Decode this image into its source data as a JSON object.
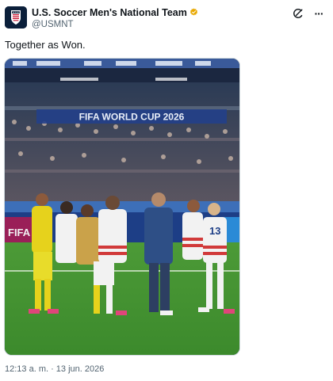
{
  "account": {
    "display_name": "U.S. Soccer Men's National Team",
    "handle": "@USMNT",
    "verified": true,
    "verified_badge_color": "#e8a800",
    "avatar_icon": "us-soccer-crest-icon"
  },
  "header_actions": [
    {
      "icon": "grok-icon"
    },
    {
      "icon": "more-icon",
      "glyph": "···"
    }
  ],
  "tweet": {
    "text": "Together as Won.",
    "media": {
      "kind": "photo",
      "banner_text": "FIFA WORLD CUP 2026",
      "board_text": "FIFA"
    }
  },
  "meta": {
    "timestamp": "12:13 a. m. · 13 jun. 2026"
  },
  "colors": {
    "text": "#0f1419",
    "secondary": "#536471",
    "border": "#cfd9de",
    "pitch": "#3f8f2e",
    "kit_yellow": "#e6d21c",
    "kit_white": "#f2f2f2",
    "kit_red_stripe": "#d13a3a",
    "staff_blue": "#2e4f86"
  }
}
